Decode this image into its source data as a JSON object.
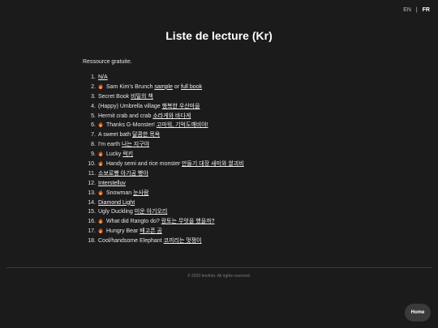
{
  "lang": {
    "en": "EN",
    "separator": "|",
    "fr": "FR"
  },
  "title": "Liste de lecture (Kr)",
  "intro": "Ressource gratuite.",
  "list": [
    {
      "num": "1.",
      "fire": false,
      "segments": [
        {
          "text": "N/A",
          "link": true
        }
      ]
    },
    {
      "num": "2.",
      "fire": true,
      "segments": [
        {
          "text": "Sam Kim's Brunch ",
          "link": false
        },
        {
          "text": "sample",
          "link": true
        },
        {
          "text": " or ",
          "link": false
        },
        {
          "text": "full book",
          "link": true
        }
      ]
    },
    {
      "num": "3.",
      "fire": false,
      "segments": [
        {
          "text": "Secret Book ",
          "link": false
        },
        {
          "text": "비밀의 책",
          "link": true
        }
      ]
    },
    {
      "num": "4.",
      "fire": false,
      "segments": [
        {
          "text": "(Happy) Umbrella village ",
          "link": false
        },
        {
          "text": "행복한 우산마을",
          "link": true
        }
      ]
    },
    {
      "num": "5.",
      "fire": false,
      "segments": [
        {
          "text": "Hermit crab and crab ",
          "link": false
        },
        {
          "text": "소라게와 바다게",
          "link": true
        }
      ]
    },
    {
      "num": "6.",
      "fire": true,
      "segments": [
        {
          "text": "Thanks G-Monster! ",
          "link": false
        },
        {
          "text": "고마워, 기억도깨비야!",
          "link": true
        }
      ]
    },
    {
      "num": "7.",
      "fire": false,
      "segments": [
        {
          "text": "A sweet bath ",
          "link": false
        },
        {
          "text": "달콤한 목욕",
          "link": true
        }
      ]
    },
    {
      "num": "8.",
      "fire": false,
      "segments": [
        {
          "text": "I'm earth ",
          "link": false
        },
        {
          "text": "나는 지구야",
          "link": true
        }
      ]
    },
    {
      "num": "9.",
      "fire": true,
      "segments": [
        {
          "text": "Lucky ",
          "link": false
        },
        {
          "text": "럭키",
          "link": true
        }
      ]
    },
    {
      "num": "10.",
      "fire": true,
      "segments": [
        {
          "text": "Handy semi and rice monster ",
          "link": false
        },
        {
          "text": "만들기 대장 새미와 쌀괴비",
          "link": true
        }
      ]
    },
    {
      "num": "11.",
      "fire": false,
      "segments": [
        {
          "text": "소보로빵 아기곰 빵야",
          "link": true
        }
      ]
    },
    {
      "num": "12.",
      "fire": false,
      "segments": [
        {
          "text": "Interstelluv",
          "link": true
        }
      ]
    },
    {
      "num": "13.",
      "fire": true,
      "segments": [
        {
          "text": "Snowman ",
          "link": false
        },
        {
          "text": "눈사람",
          "link": true
        }
      ]
    },
    {
      "num": "14.",
      "fire": false,
      "segments": [
        {
          "text": "Diamond Light",
          "link": true
        }
      ]
    },
    {
      "num": "15.",
      "fire": false,
      "segments": [
        {
          "text": "Ugly Duckling ",
          "link": false
        },
        {
          "text": "미운 아기오리",
          "link": true
        }
      ]
    },
    {
      "num": "16.",
      "fire": true,
      "segments": [
        {
          "text": "What did Rangto do? ",
          "link": false
        },
        {
          "text": "랑토는 무엇을 했을까?",
          "link": true
        }
      ]
    },
    {
      "num": "17.",
      "fire": true,
      "segments": [
        {
          "text": "Hungry Bear ",
          "link": false
        },
        {
          "text": "배고픈 곰",
          "link": true
        }
      ]
    },
    {
      "num": "18.",
      "fire": false,
      "segments": [
        {
          "text": "Cool/handsome Elephant ",
          "link": false
        },
        {
          "text": "코끼리는 멋쟁이",
          "link": true
        }
      ]
    }
  ],
  "footer": {
    "copyright": "© 2020 fenrihm. All rights reserved."
  },
  "home_button": {
    "label": "Home"
  },
  "icons": {
    "list_marker": "fire-icon"
  },
  "colors": {
    "background": "#1b1b1b",
    "text": "#ececec",
    "fire_outer": "#e8542b",
    "fire_inner": "#f6b33b",
    "home_button_bg": "#3a3a3a"
  }
}
